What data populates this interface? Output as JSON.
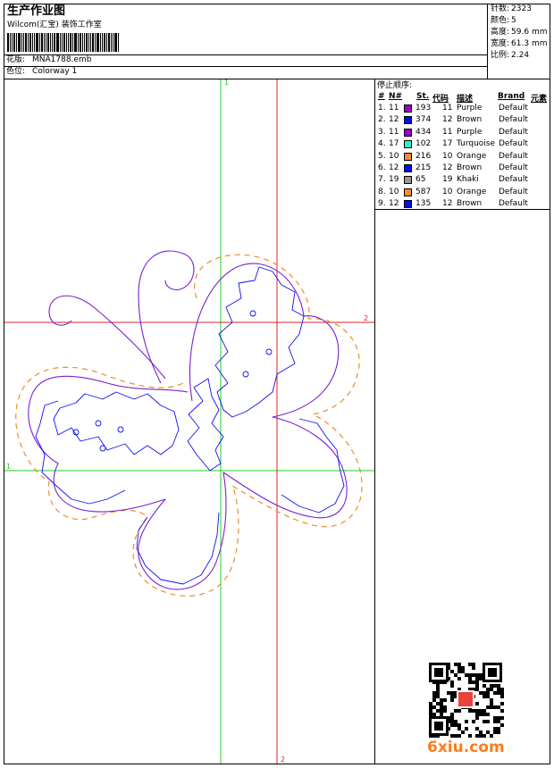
{
  "header": {
    "title": "生产作业图",
    "company": "Wilcom(汇宝) 装饰工作室",
    "design_label": "花版:",
    "design_value": "MNA1788.emb",
    "colorway_label": "色位:",
    "colorway_value": "Colorway 1"
  },
  "stats": [
    {
      "label": "针数:",
      "value": "2323"
    },
    {
      "label": "颜色:",
      "value": "5"
    },
    {
      "label": "高度:",
      "value": "59.6 mm"
    },
    {
      "label": "宽度:",
      "value": "61.3 mm"
    },
    {
      "label": "比例:",
      "value": "2.24"
    }
  ],
  "sequence": {
    "title": "停止顺序:",
    "columns": [
      "#",
      "N#",
      "St.",
      "代码",
      "描述",
      "Brand",
      "元素"
    ],
    "rows": [
      {
        "idx": "1.",
        "n": "11",
        "color": "#9900cc",
        "st": "193",
        "code": "11",
        "desc": "Purple",
        "brand": "Default"
      },
      {
        "idx": "2.",
        "n": "12",
        "color": "#0011ee",
        "st": "374",
        "code": "12",
        "desc": "Brown",
        "brand": "Default"
      },
      {
        "idx": "3.",
        "n": "11",
        "color": "#9900cc",
        "st": "434",
        "code": "11",
        "desc": "Purple",
        "brand": "Default"
      },
      {
        "idx": "4.",
        "n": "17",
        "color": "#33eecc",
        "st": "102",
        "code": "17",
        "desc": "Turquoise",
        "brand": "Default"
      },
      {
        "idx": "5.",
        "n": "10",
        "color": "#ff8833",
        "st": "216",
        "code": "10",
        "desc": "Orange",
        "brand": "Default"
      },
      {
        "idx": "6.",
        "n": "12",
        "color": "#0011ee",
        "st": "215",
        "code": "12",
        "desc": "Brown",
        "brand": "Default"
      },
      {
        "idx": "7.",
        "n": "19",
        "color": "#999999",
        "st": "65",
        "code": "19",
        "desc": "Khaki",
        "brand": "Default"
      },
      {
        "idx": "8.",
        "n": "10",
        "color": "#ff8833",
        "st": "587",
        "code": "10",
        "desc": "Orange",
        "brand": "Default"
      },
      {
        "idx": "9.",
        "n": "12",
        "color": "#0011ee",
        "st": "135",
        "code": "12",
        "desc": "Brown",
        "brand": "Default"
      }
    ]
  },
  "guides": {
    "green_v_label": "1",
    "green_h_label": "1",
    "red_h_label": "2",
    "red_v_label": "2",
    "green_color": "#22cc22",
    "red_color": "#dd2222"
  },
  "stitch_colors": {
    "purple": "#7a20d0",
    "blue": "#1010ee",
    "orange": "#f08a2a"
  },
  "watermark": {
    "site": "6xiu.com",
    "icon": "qr-code-icon"
  }
}
